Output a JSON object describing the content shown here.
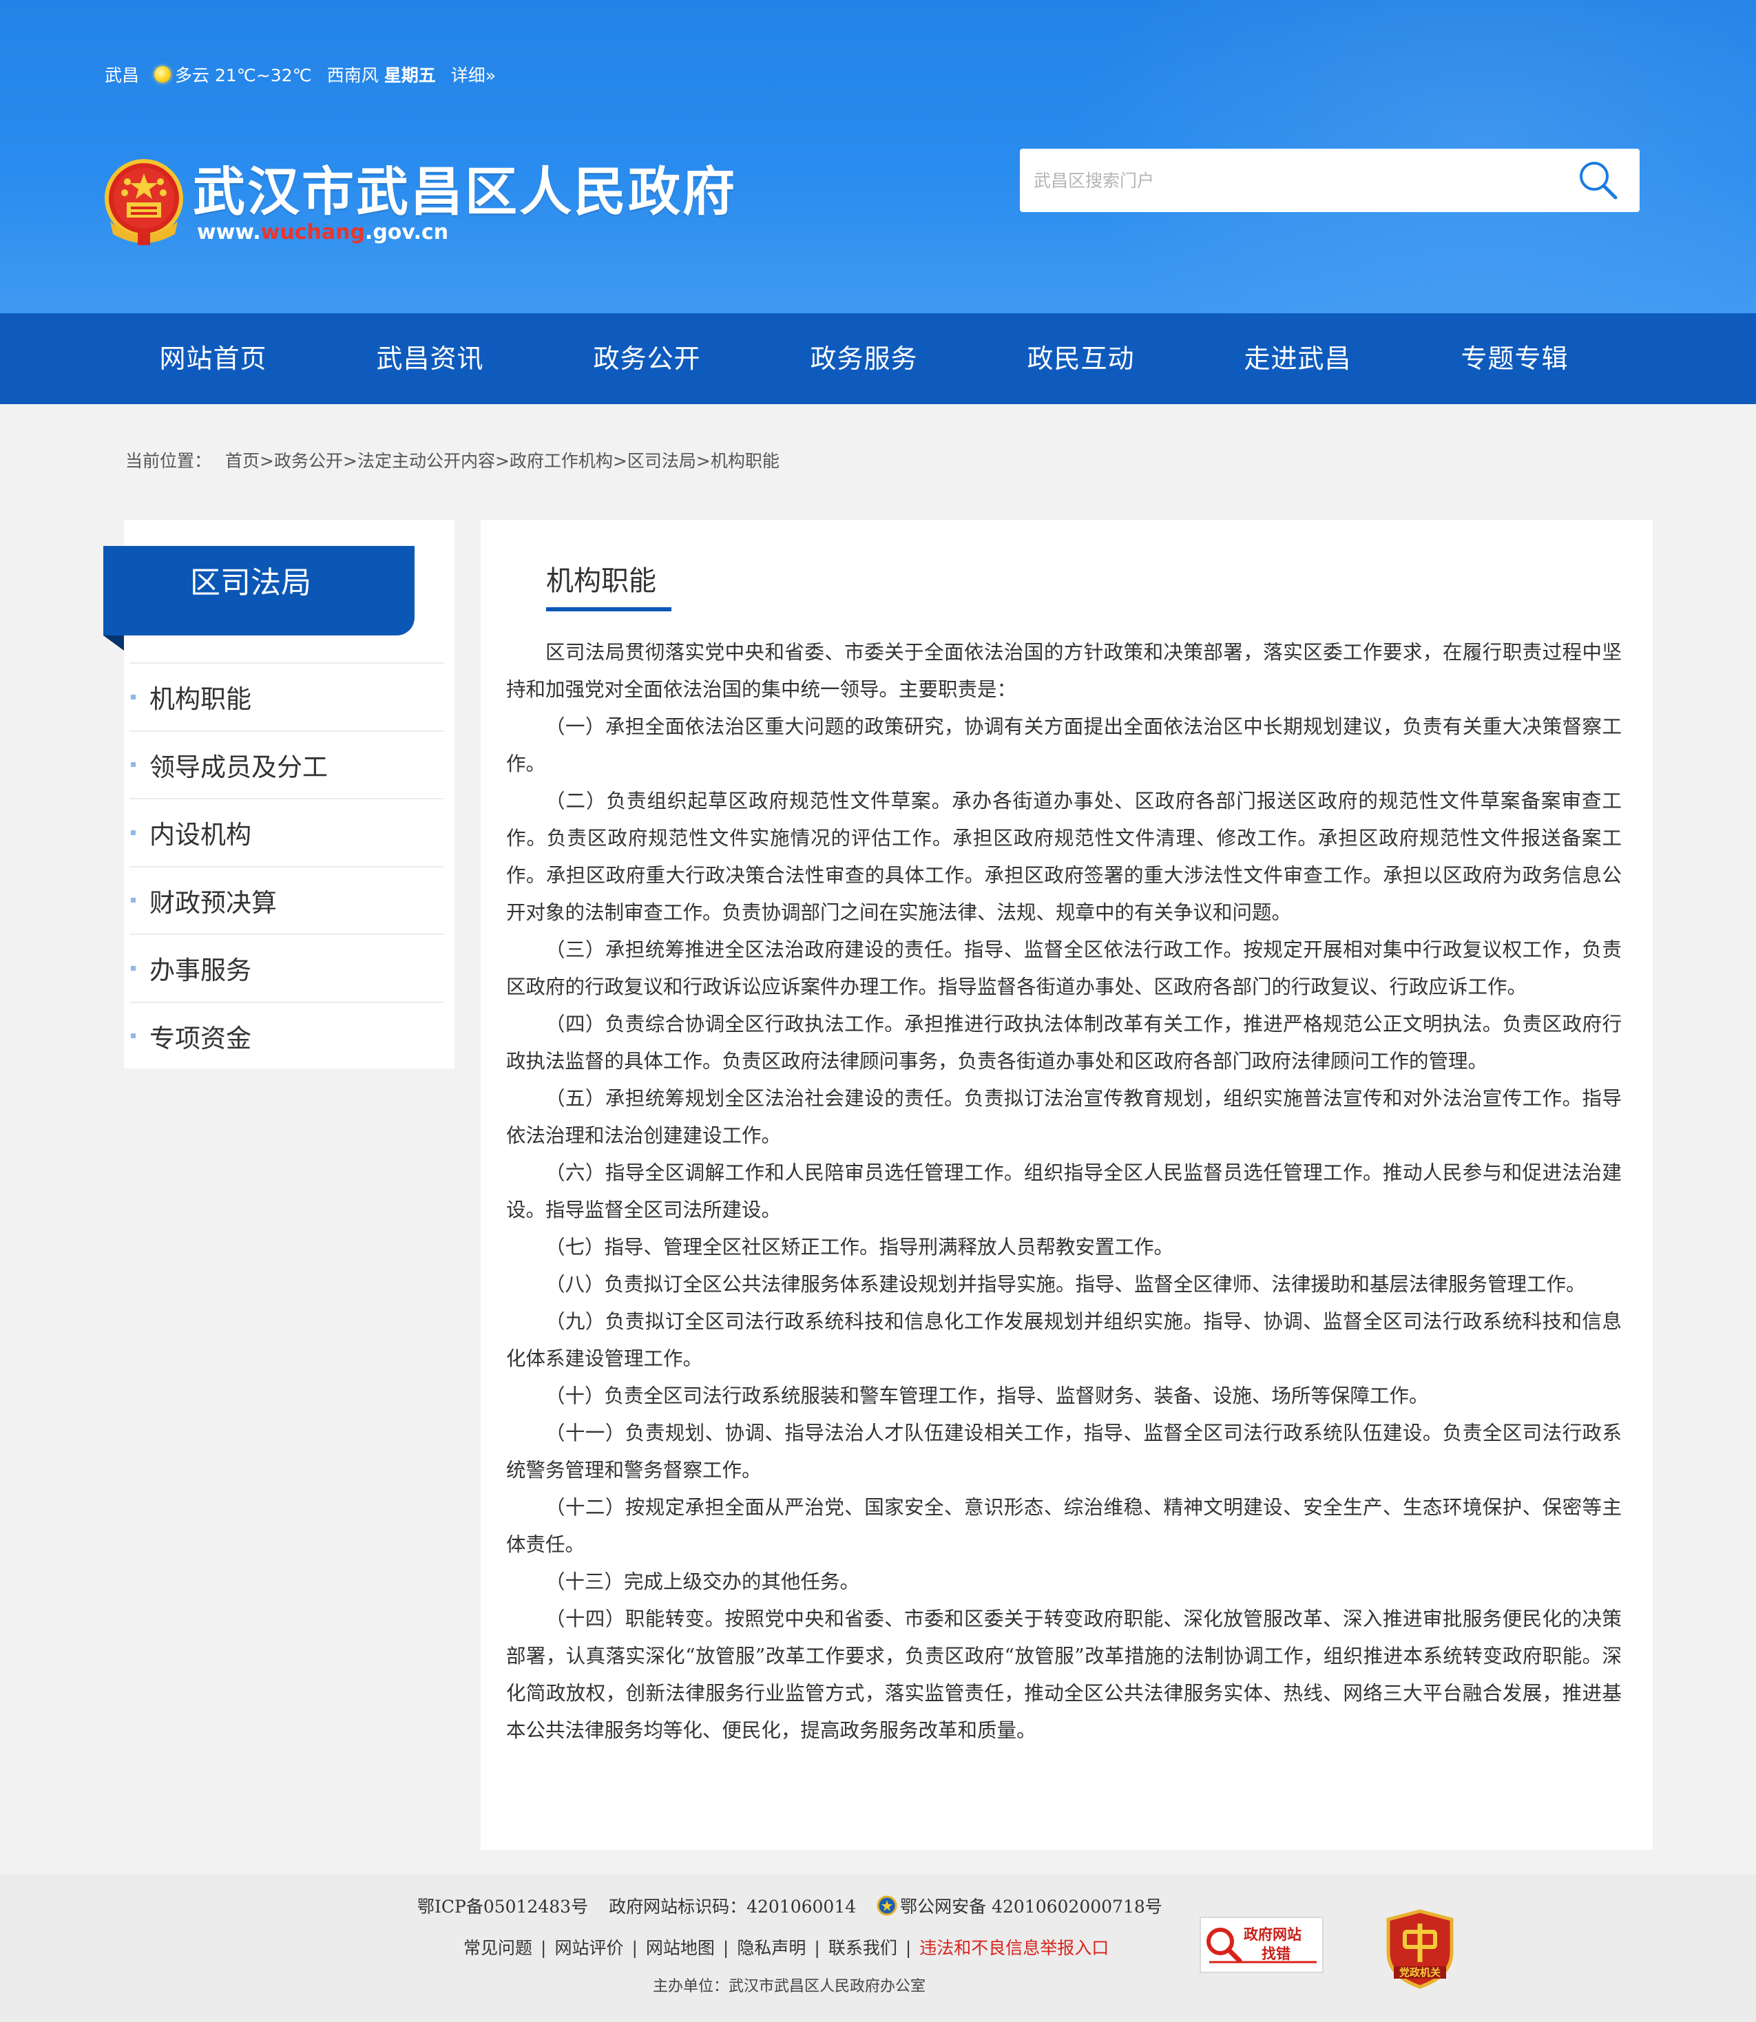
{
  "header": {
    "weather": {
      "city": "武昌",
      "condition_temp": "多云 21℃~32℃",
      "wind": "西南风",
      "weekday": "星期五",
      "detail_link": "详细»"
    },
    "site_title": "武汉市武昌区人民政府",
    "site_url_prefix": "www.",
    "site_url_highlight": "wuchang",
    "site_url_suffix": ".gov.cn",
    "search": {
      "placeholder": "武昌区搜索门户"
    }
  },
  "nav": {
    "items": [
      {
        "label": "网站首页"
      },
      {
        "label": "武昌资讯"
      },
      {
        "label": "政务公开"
      },
      {
        "label": "政务服务"
      },
      {
        "label": "政民互动"
      },
      {
        "label": "走进武昌"
      },
      {
        "label": "专题专辑"
      }
    ]
  },
  "breadcrumb": {
    "label": "当前位置：",
    "items": [
      "首页",
      "政务公开",
      "法定主动公开内容",
      "政府工作机构",
      "区司法局",
      "机构职能"
    ],
    "separator": ">"
  },
  "sidebar": {
    "title": "区司法局",
    "items": [
      {
        "label": "机构职能"
      },
      {
        "label": "领导成员及分工"
      },
      {
        "label": "内设机构"
      },
      {
        "label": "财政预决算"
      },
      {
        "label": "办事服务"
      },
      {
        "label": "专项资金"
      }
    ]
  },
  "main": {
    "title": "机构职能",
    "paragraphs": [
      "区司法局贯彻落实党中央和省委、市委关于全面依法治国的方针政策和决策部署，落实区委工作要求，在履行职责过程中坚持和加强党对全面依法治国的集中统一领导。主要职责是：",
      "（一）承担全面依法治区重大问题的政策研究，协调有关方面提出全面依法治区中长期规划建议，负责有关重大决策督察工作。",
      "（二）负责组织起草区政府规范性文件草案。承办各街道办事处、区政府各部门报送区政府的规范性文件草案备案审查工作。负责区政府规范性文件实施情况的评估工作。承担区政府规范性文件清理、修改工作。承担区政府规范性文件报送备案工作。承担区政府重大行政决策合法性审查的具体工作。承担区政府签署的重大涉法性文件审查工作。承担以区政府为政务信息公开对象的法制审查工作。负责协调部门之间在实施法律、法规、规章中的有关争议和问题。",
      "（三）承担统筹推进全区法治政府建设的责任。指导、监督全区依法行政工作。按规定开展相对集中行政复议权工作，负责区政府的行政复议和行政诉讼应诉案件办理工作。指导监督各街道办事处、区政府各部门的行政复议、行政应诉工作。",
      "（四）负责综合协调全区行政执法工作。承担推进行政执法体制改革有关工作，推进严格规范公正文明执法。负责区政府行政执法监督的具体工作。负责区政府法律顾问事务，负责各街道办事处和区政府各部门政府法律顾问工作的管理。",
      "（五）承担统筹规划全区法治社会建设的责任。负责拟订法治宣传教育规划，组织实施普法宣传和对外法治宣传工作。指导依法治理和法治创建建设工作。",
      "（六）指导全区调解工作和人民陪审员选任管理工作。组织指导全区人民监督员选任管理工作。推动人民参与和促进法治建设。指导监督全区司法所建设。",
      "（七）指导、管理全区社区矫正工作。指导刑满释放人员帮教安置工作。",
      "（八）负责拟订全区公共法律服务体系建设规划并指导实施。指导、监督全区律师、法律援助和基层法律服务管理工作。",
      "（九）负责拟订全区司法行政系统科技和信息化工作发展规划并组织实施。指导、协调、监督全区司法行政系统科技和信息化体系建设管理工作。",
      "（十）负责全区司法行政系统服装和警车管理工作，指导、监督财务、装备、设施、场所等保障工作。",
      "（十一）负责规划、协调、指导法治人才队伍建设相关工作，指导、监督全区司法行政系统队伍建设。负责全区司法行政系统警务管理和警务督察工作。",
      "（十二）按规定承担全面从严治党、国家安全、意识形态、综治维稳、精神文明建设、安全生产、生态环境保护、保密等主体责任。",
      "（十三）完成上级交办的其他任务。",
      "（十四）职能转变。按照党中央和省委、市委和区委关于转变政府职能、深化放管服改革、深入推进审批服务便民化的决策部署，认真落实深化“放管服”改革工作要求，负责区政府“放管服”改革措施的法制协调工作，组织推进本系统转变政府职能。深化简政放权，创新法律服务行业监管方式，落实监管责任，推动全区公共法律服务实体、热线、网络三大平台融合发展，推进基本公共法律服务均等化、便民化，提高政务服务改革和质量。"
    ]
  },
  "footer": {
    "icp": "鄂ICP备05012483号",
    "site_code": "政府网站标识码：4201060014",
    "police_record": "鄂公网安备 42010602000718号",
    "links": [
      {
        "label": "常见问题"
      },
      {
        "label": "网站评价"
      },
      {
        "label": "网站地图"
      },
      {
        "label": "隐私声明"
      },
      {
        "label": "联系我们"
      },
      {
        "label": "违法和不良信息举报入口",
        "highlight": true
      }
    ],
    "link_separator": "|",
    "sponsor": "主办单位：武汉市武昌区人民政府办公室",
    "badge_jiucuo_line1": "政府网站",
    "badge_jiucuo_line2": "找错",
    "badge_dangzheng": "党政机关"
  },
  "colors": {
    "header_blue": "#2383e6",
    "nav_blue": "#0e5bbd",
    "accent_blue": "#0b57b5",
    "report_red": "#d8231b"
  }
}
